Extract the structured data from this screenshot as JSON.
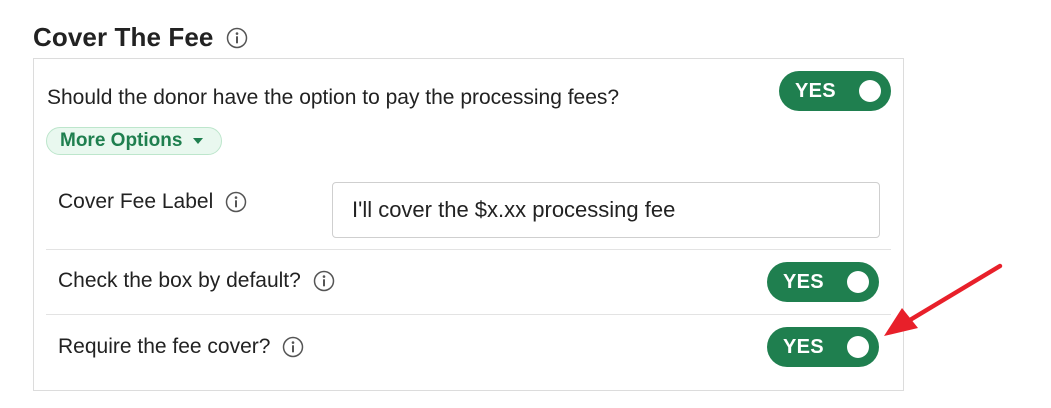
{
  "section": {
    "title": "Cover The Fee",
    "info_icon": "info-circle-icon"
  },
  "main_setting": {
    "question": "Should the donor have the option to pay the processing fees?",
    "toggle_label": "YES",
    "toggle_on": true
  },
  "more_options": {
    "label": "More Options",
    "icon": "caret-down-icon"
  },
  "cover_fee_label": {
    "label": "Cover Fee Label",
    "value": "I'll cover the $x.xx processing fee"
  },
  "check_default": {
    "label": "Check the box by default?",
    "toggle_label": "YES",
    "toggle_on": true
  },
  "require_fee": {
    "label": "Require the fee cover?",
    "toggle_label": "YES",
    "toggle_on": true
  },
  "colors": {
    "toggle_green": "#1f7f4f",
    "pill_background": "#e9f8ef",
    "annotation_arrow": "#e8202a"
  }
}
